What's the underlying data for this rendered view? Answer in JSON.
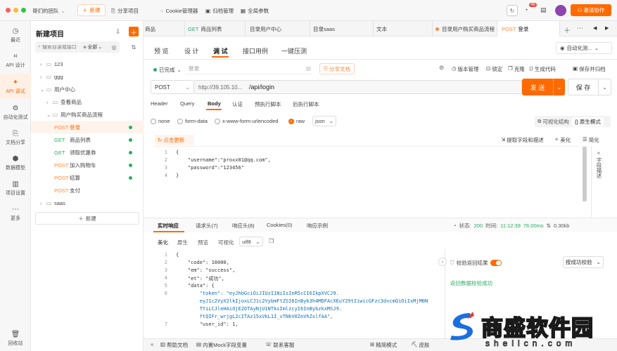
{
  "topbar": {
    "team": "哥们的团队",
    "new": "新建",
    "share": "分享项目",
    "cookie": "Cookie管理器",
    "archive": "归档管理",
    "globals": "全局参数",
    "badge": "48",
    "invite": "邀请协作"
  },
  "sidebar": {
    "items": [
      {
        "label": "最近"
      },
      {
        "label": "API 设计"
      },
      {
        "label": "API 调试"
      },
      {
        "label": "自动化测试"
      },
      {
        "label": "文档分享"
      },
      {
        "label": "数据模型"
      },
      {
        "label": "项目设置"
      },
      {
        "label": "更多"
      }
    ],
    "recycle": "回收站"
  },
  "tree": {
    "title": "新建项目",
    "search_placeholder": "搜索目录或接口",
    "filter": "全部",
    "nodes": [
      {
        "label": "123"
      },
      {
        "label": "ggg"
      },
      {
        "label": "用户中心"
      },
      {
        "label": "查看商品"
      },
      {
        "label": "用户购买商品流程"
      }
    ],
    "apis": [
      {
        "method": "POST",
        "name": "登录"
      },
      {
        "method": "GET",
        "name": "商品列表"
      },
      {
        "method": "GET",
        "name": "领取优惠券"
      },
      {
        "method": "POST",
        "name": "加入购物车"
      },
      {
        "method": "POST",
        "name": "结算"
      },
      {
        "method": "POST",
        "name": "支付"
      }
    ],
    "saas": "saas",
    "new_btn": "新建"
  },
  "tabs": [
    {
      "method": "",
      "label": "商品"
    },
    {
      "method": "GET",
      "label": "商品列表"
    },
    {
      "method": "",
      "label": "目录用户中心"
    },
    {
      "method": "",
      "label": "目录saas"
    },
    {
      "method": "",
      "label": "文本"
    },
    {
      "method": "",
      "label": "目录用户购买商品流程"
    },
    {
      "method": "POST",
      "label": "登录"
    }
  ],
  "subtabs": {
    "items": [
      "预 览",
      "设 计",
      "调 试",
      "接口用例",
      "一键压测"
    ],
    "auto": "自动化测..."
  },
  "meta": {
    "status": "已完成",
    "login": "登录",
    "share_doc": "分享文档",
    "version": "版本管理",
    "lock": "锁定",
    "clone": "克隆",
    "gen_code": "生成代码",
    "save_as": "保存并归档"
  },
  "request": {
    "method": "POST",
    "base": "http://39.105.10...",
    "path": "/api/login",
    "send": "发 送",
    "save": "保 存"
  },
  "req_tabs": [
    "Header",
    "Query",
    "Body",
    "认证",
    "预执行脚本",
    "后执行脚本"
  ],
  "body_types": {
    "none": "none",
    "form": "form-data",
    "urlencoded": "x-www-form-urlencoded",
    "raw": "raw",
    "fmt": "json",
    "visual": "可视化结构",
    "native": "原生模式"
  },
  "editor": {
    "refresh": "点击更新",
    "extract": "提取字段和描述",
    "beautify": "美化",
    "simplify": "简化",
    "field_desc": "字段描述",
    "lines": [
      "{",
      "    \"username\":\"proxx01@qq.com\",",
      "    \"password\":\"123456\"",
      "}"
    ]
  },
  "response": {
    "tabs": [
      "实时响应",
      "请求头(7)",
      "响应头(8)",
      "Cookies(0)",
      "响应示例"
    ],
    "status_label": "状态:",
    "status_code": "200",
    "time_label": "时间:",
    "time_value": "11:12:39",
    "duration": "76.00ms",
    "size": "0.30kb",
    "views": [
      "美化",
      "原生",
      "预览",
      "可视化"
    ],
    "encoding": "utf8",
    "verify": "校验返回结果",
    "verify_mode": "按成功校验",
    "verify_msg": "返回数据校验成功",
    "line_numbers": [
      "1",
      "2",
      "3",
      "4",
      "5",
      "6",
      "",
      "",
      "",
      "7"
    ],
    "lines": [
      "{",
      "    \"code\": 10000,",
      "    \"em\": \"success\",",
      "    \"et\": \"成功\",",
      "    \"data\": {",
      "        \"token\": \"eyJhbGciOiJIUzI1NiIsInR5cCI6IkpXVCJ9.",
      "        eyJ1c2VyX2lkIjoxLCJ1c2VybmFtZSI6InByb3h4MDFAcXEuY29tIiwicGFzc3dvcmQiOiIxMjM0N",
      "        TYiLCJleHAiOjE2OTAyNjU1NTksImlzcyI6InBybzkxMSJ9.",
      "        ftQIFr_wrjgL2cITAz15xVkL1I_vTNkV0ZeVhZxlfAA\",",
      "        \"user_id\": 1,"
    ]
  },
  "bottom": {
    "help": "帮助文档",
    "mock": "内置Mock字段变量",
    "contact": "联系客服",
    "compact": "精简模式",
    "skin": "皮肤"
  },
  "watermark": {
    "cn": "商盛软件园",
    "en": "shellcn.com"
  },
  "colors": {
    "accent": "#ff6a00",
    "get": "#27ae60",
    "post": "#ff8a3d"
  }
}
